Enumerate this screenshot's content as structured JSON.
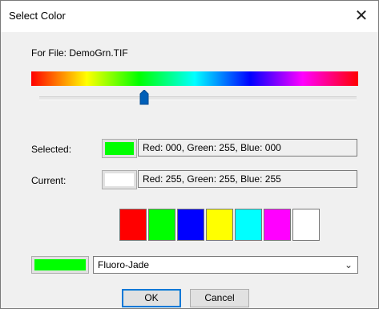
{
  "window": {
    "title": "Select Color",
    "close_glyph": "✕"
  },
  "file_label": "For File: DemoGrn.TIF",
  "hue_slider": {
    "position": 0.33
  },
  "selected": {
    "label": "Selected:",
    "color": "#00ff00",
    "readout": "Red: 000, Green: 255, Blue: 000"
  },
  "current": {
    "label": "Current:",
    "color": "#ffffff",
    "readout": "Red: 255, Green: 255, Blue: 255"
  },
  "palette": [
    "#ff0000",
    "#00ff00",
    "#0000ff",
    "#ffff00",
    "#00ffff",
    "#ff00ff",
    "#ffffff"
  ],
  "dye": {
    "color": "#00ff00",
    "selected_value": "Fluoro-Jade",
    "chevron_icon": "chevron-down-icon"
  },
  "buttons": {
    "ok": "OK",
    "cancel": "Cancel"
  }
}
